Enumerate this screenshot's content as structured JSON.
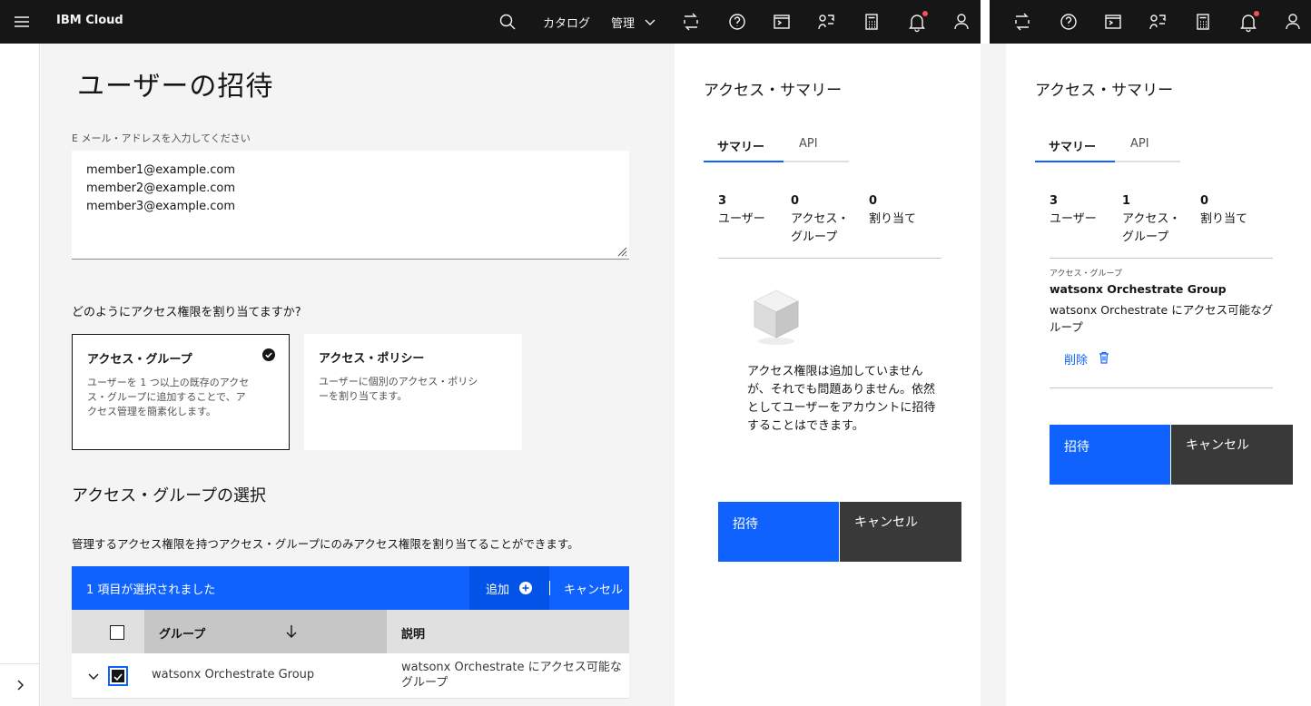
{
  "header": {
    "brand": "IBM Cloud",
    "catalog": "カタログ",
    "manage": "管理"
  },
  "main": {
    "title": "ユーザーの招待",
    "email_label": "E メール・アドレスを入力してください",
    "emails": [
      "member1@example.com",
      "member2@example.com",
      "member3@example.com"
    ],
    "question": "どのようにアクセス権限を割り当てますか?",
    "option_group": {
      "title": "アクセス・グループ",
      "desc": "ユーザーを 1 つ以上の既存のアクセス・グループに追加することで、アクセス管理を簡素化します。"
    },
    "option_policy": {
      "title": "アクセス・ポリシー",
      "desc": "ユーザーに個別のアクセス・ポリシーを割り当てます。"
    },
    "select_title": "アクセス・グループの選択",
    "select_desc": "管理するアクセス権限を持つアクセス・グループにのみアクセス権限を割り当てることができます。",
    "batch": {
      "selected": "1 項目が選択されました",
      "add": "追加",
      "cancel": "キャンセル"
    },
    "table": {
      "col_group": "グループ",
      "col_desc": "説明",
      "rows": [
        {
          "group": "watsonx Orchestrate Group",
          "desc": "watsonx Orchestrate にアクセス可能なグループ"
        }
      ]
    }
  },
  "summary1": {
    "title": "アクセス・サマリー",
    "tab_summary": "サマリー",
    "tab_api": "API",
    "users_count": "3",
    "users_label": "ユーザー",
    "groups_count": "0",
    "groups_label": "アクセス・グループ",
    "assign_count": "0",
    "assign_label": "割り当て",
    "empty_text": "アクセス権限は追加していませんが、それでも問題ありません。依然としてユーザーをアカウントに招待することはできます。",
    "invite": "招待",
    "cancel": "キャンセル"
  },
  "summary2": {
    "title": "アクセス・サマリー",
    "tab_summary": "サマリー",
    "tab_api": "API",
    "users_count": "3",
    "users_label": "ユーザー",
    "groups_count": "1",
    "groups_label": "アクセス・グループ",
    "assign_count": "0",
    "assign_label": "割り当て",
    "group_caption": "アクセス・グループ",
    "group_name": "watsonx Orchestrate Group",
    "group_desc": "watsonx Orchestrate にアクセス可能なグループ",
    "remove": "削除",
    "invite": "招待",
    "cancel": "キャンセル"
  },
  "colors": {
    "accent": "#0f62fe",
    "header_bg": "#161616",
    "notification": "#fa4d56"
  },
  "icons": [
    "menu-icon",
    "search-icon",
    "chevron-down-icon",
    "switcher-icon",
    "help-icon",
    "terminal-icon",
    "cost-icon",
    "calculator-icon",
    "notification-icon",
    "user-icon",
    "checkmark-icon",
    "add-icon",
    "arrow-down-icon",
    "trash-icon",
    "chevron-right-icon",
    "box-icon"
  ]
}
